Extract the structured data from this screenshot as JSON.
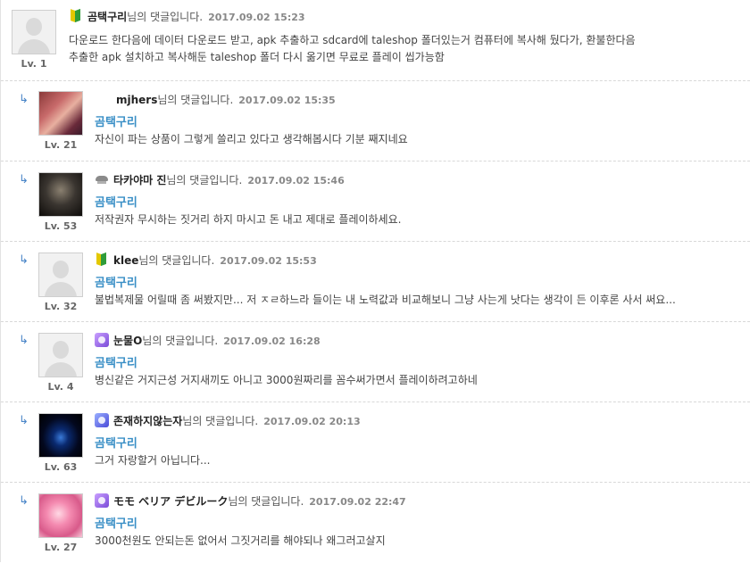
{
  "suffix": "님의 댓글입니다.",
  "level_prefix": "Lv.",
  "comments": [
    {
      "nick": "곰택구리",
      "date": "2017.09.02 15:23",
      "level": "1",
      "lines": [
        "다운로드 한다음에 데이터 다운로드 받고, apk 추출하고 sdcard에 taleshop 폴더있는거 컴퓨터에 복사해 뒀다가, 환불한다음",
        "추출한 apk 설치하고 복사해둔 taleshop 폴더 다시 옮기면 무료로 플레이 씹가능함"
      ]
    },
    {
      "nick": "mjhers",
      "date": "2017.09.02 15:35",
      "level": "21",
      "mention": "곰택구리",
      "text": "자신이 파는 상품이 그렇게 쓸리고 있다고 생각해봅시다 기분 째지네요"
    },
    {
      "nick": "타카야마 진",
      "date": "2017.09.02 15:46",
      "level": "53",
      "mention": "곰택구리",
      "text": "저작권자 무시하는 짓거리 하지 마시고 돈 내고 제대로 플레이하세요."
    },
    {
      "nick": "klee",
      "date": "2017.09.02 15:53",
      "level": "32",
      "mention": "곰택구리",
      "text": "불법복제물 어릴때 좀 써봤지만... 저 ㅈㄹ하느라 들이는 내 노력값과 비교해보니 그냥 사는게 낫다는 생각이 든 이후론 사서 써요..."
    },
    {
      "nick": "눈물O",
      "date": "2017.09.02 16:28",
      "level": "4",
      "mention": "곰택구리",
      "text": "병신같은 거지근성 거지새끼도 아니고 3000원짜리를 꼼수써가면서 플레이하려고하네"
    },
    {
      "nick": "존재하지않는자",
      "date": "2017.09.02 20:13",
      "level": "63",
      "mention": "곰택구리",
      "text": "그거 자랑할거 아닙니다..."
    },
    {
      "nick": "モモ ベリア デビルーク",
      "date": "2017.09.02 22:47",
      "level": "27",
      "mention": "곰택구리",
      "text": "3000천원도 안되는돈 없어서 그짓거리를 해야되나 왜그러고살지"
    }
  ],
  "icons": {
    "reply_arrow": "reply-arrow-icon",
    "badge_beginner": "beginner-badge-icon",
    "badge_grade": "grade-badge-icon",
    "badge_muted": "muted-badge-icon",
    "avatar_placeholder": "avatar-placeholder-icon"
  }
}
